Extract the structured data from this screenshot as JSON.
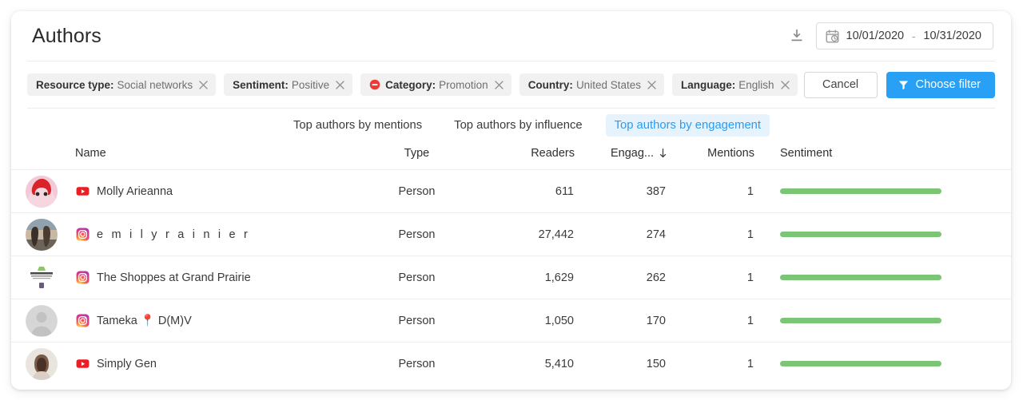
{
  "header": {
    "title": "Authors",
    "download_icon": "download-icon",
    "date_range": {
      "icon": "calendar-clock-icon",
      "start": "10/01/2020",
      "separator": "-",
      "end": "10/31/2020"
    }
  },
  "filters": {
    "chips": [
      {
        "key": "Resource type:",
        "value": "Social networks",
        "excluded": false
      },
      {
        "key": "Sentiment:",
        "value": "Positive",
        "excluded": false
      },
      {
        "key": "Category:",
        "value": "Promotion",
        "excluded": true
      },
      {
        "key": "Country:",
        "value": "United States",
        "excluded": false
      },
      {
        "key": "Language:",
        "value": "English",
        "excluded": false
      }
    ],
    "cancel_label": "Cancel",
    "choose_filter_label": "Choose filter",
    "choose_filter_icon": "funnel-icon",
    "accent_color": "#28a0f5"
  },
  "tabs": [
    {
      "label": "Top authors by mentions",
      "active": false
    },
    {
      "label": "Top authors by influence",
      "active": false
    },
    {
      "label": "Top authors by engagement",
      "active": true
    }
  ],
  "table": {
    "columns": {
      "name": "Name",
      "type": "Type",
      "readers": "Readers",
      "engagement": "Engag...",
      "mentions": "Mentions",
      "sentiment": "Sentiment"
    },
    "sort": {
      "column": "engagement",
      "direction": "desc",
      "icon": "arrow-down-icon"
    },
    "sentiment_bar_color": "#7cc576",
    "rows": [
      {
        "avatar": "photo-avatar-red-hair",
        "avatar_shape": "circle",
        "source": "youtube",
        "name": "Molly Arieanna",
        "type": "Person",
        "readers": "611",
        "engagement": "387",
        "mentions": "1",
        "sentiment_pct": 100
      },
      {
        "avatar": "photo-avatar-two-people",
        "avatar_shape": "circle",
        "source": "instagram",
        "name": "e m i l y r a i n i e r",
        "type": "Person",
        "readers": "27,442",
        "engagement": "274",
        "mentions": "1",
        "sentiment_pct": 100
      },
      {
        "avatar": "logo-avatar-the-shoppes",
        "avatar_shape": "square",
        "source": "instagram",
        "name": "The Shoppes at Grand Prairie",
        "type": "Person",
        "readers": "1,629",
        "engagement": "262",
        "mentions": "1",
        "sentiment_pct": 100
      },
      {
        "avatar": "default-silhouette-avatar",
        "avatar_shape": "circle",
        "source": "instagram",
        "name": "Tameka 📍 D(M)V",
        "type": "Person",
        "readers": "1,050",
        "engagement": "170",
        "mentions": "1",
        "sentiment_pct": 100
      },
      {
        "avatar": "photo-avatar-woman-dark-hair",
        "avatar_shape": "circle",
        "source": "youtube",
        "name": "Simply Gen",
        "type": "Person",
        "readers": "5,410",
        "engagement": "150",
        "mentions": "1",
        "sentiment_pct": 100
      }
    ]
  }
}
